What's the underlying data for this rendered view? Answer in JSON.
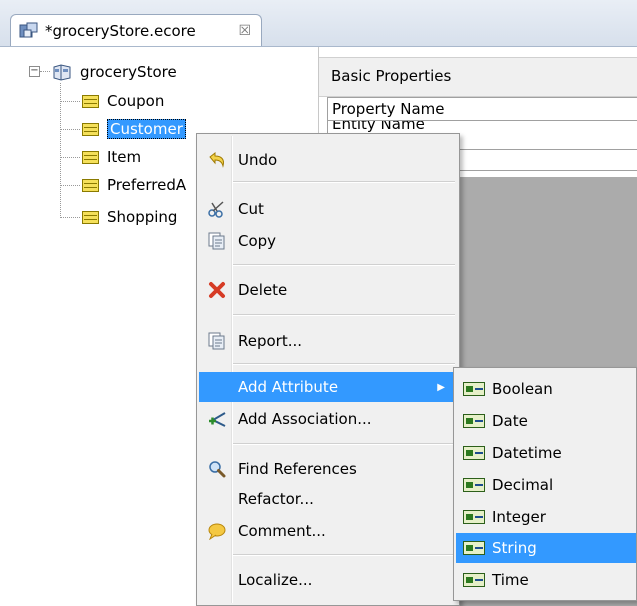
{
  "tab": {
    "title": "*groceryStore.ecore",
    "close": "☒"
  },
  "tree": {
    "root": "groceryStore",
    "items": [
      "Coupon",
      "Customer",
      "Item",
      "PreferredA",
      "Shopping"
    ]
  },
  "properties": {
    "section_title": "Basic Properties",
    "column_header": "Property Name",
    "first_row": "Entity Name"
  },
  "menu": {
    "undo": "Undo",
    "cut": "Cut",
    "copy": "Copy",
    "delete": "Delete",
    "report": "Report...",
    "add_attribute": "Add Attribute",
    "add_association": "Add Association...",
    "find_references": "Find References",
    "refactor": "Refactor...",
    "comment": "Comment...",
    "localize": "Localize..."
  },
  "submenu": {
    "items": [
      "Boolean",
      "Date",
      "Datetime",
      "Decimal",
      "Integer",
      "String",
      "Time"
    ],
    "selected": "String"
  },
  "colors": {
    "highlight": "#3399ff",
    "menu_bg": "#f0f0f0",
    "gray_area": "#ababab"
  }
}
